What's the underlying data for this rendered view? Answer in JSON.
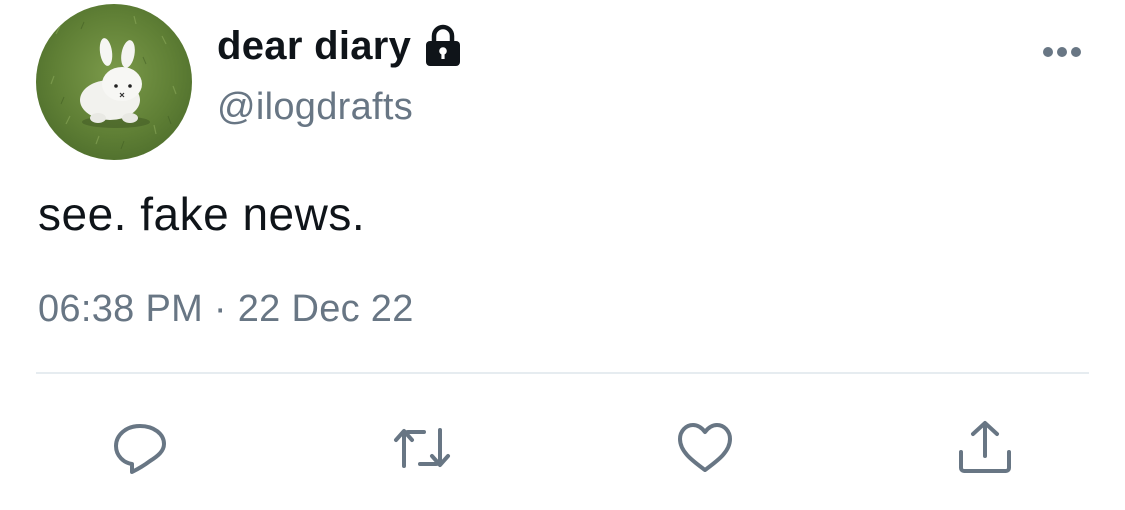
{
  "tweet": {
    "display_name": "dear diary",
    "handle": "@ilogdrafts",
    "text": "see. fake news.",
    "time": "06:38 PM",
    "separator": "·",
    "date": "22 Dec 22"
  },
  "icons": {
    "protected": "lock-icon",
    "more": "more-options-icon",
    "reply": "reply-icon",
    "retweet": "retweet-icon",
    "like": "heart-icon",
    "share": "share-icon"
  },
  "colors": {
    "primary_text": "#0f1419",
    "secondary_text": "#687684",
    "divider": "#e6ecf0"
  }
}
